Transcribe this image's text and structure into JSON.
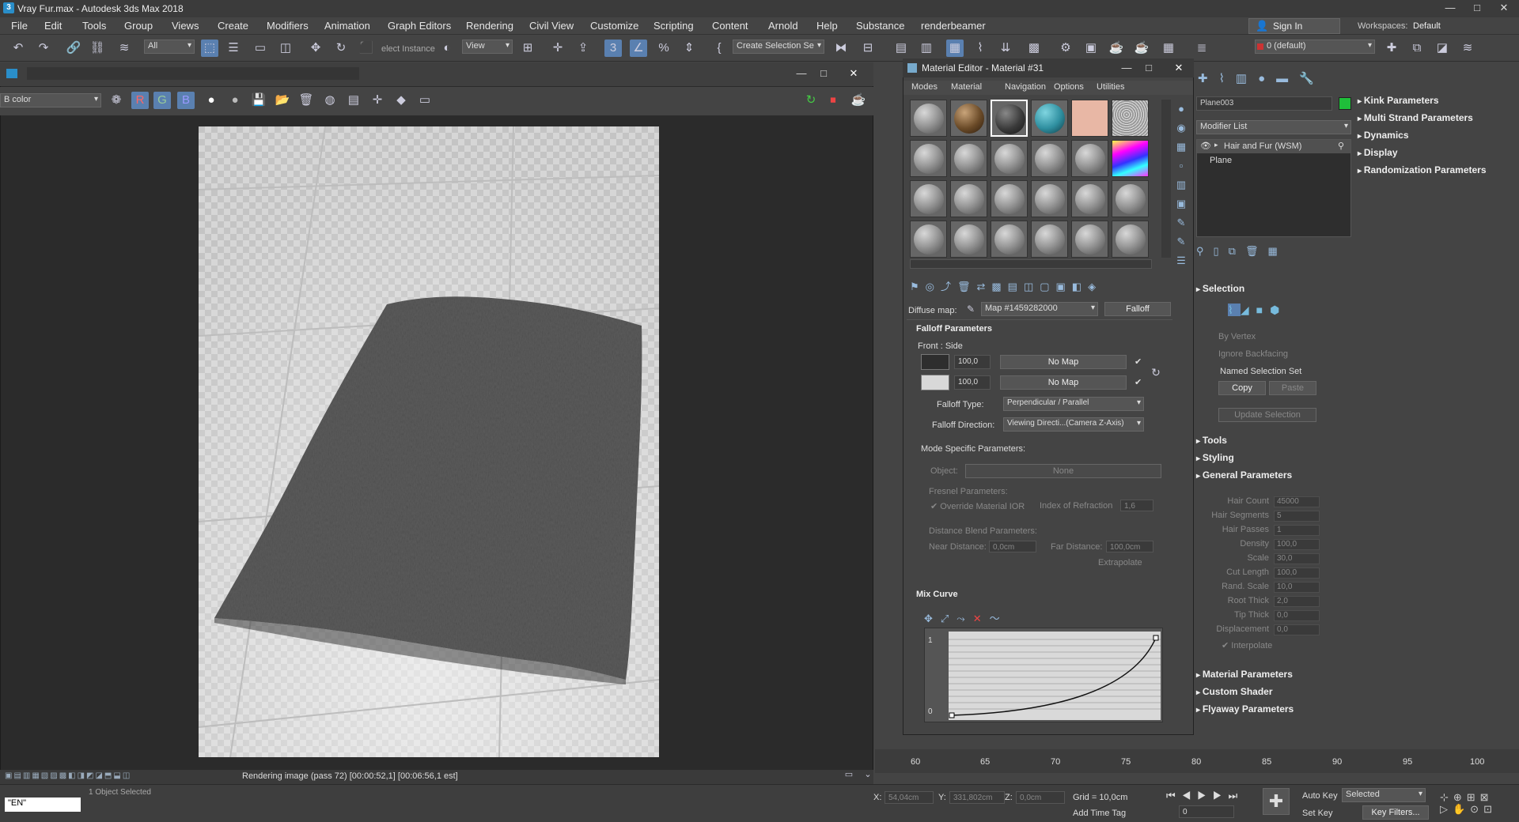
{
  "window": {
    "title": "Vray Fur.max - Autodesk 3ds Max 2018",
    "min": "—",
    "max": "□",
    "close": "✕"
  },
  "menu": [
    "File",
    "Edit",
    "Tools",
    "Group",
    "Views",
    "Create",
    "Modifiers",
    "Animation",
    "Graph Editors",
    "Rendering",
    "Civil View",
    "Customize",
    "Scripting",
    "Content",
    "Arnold",
    "Help",
    "Substance",
    "renderbeamer"
  ],
  "signin": "Sign In",
  "workspaces": {
    "label": "Workspaces:",
    "value": "Default"
  },
  "toolbar": {
    "filter": "All",
    "select_instance": "elect Instance",
    "view": "View",
    "create_selection_set": "Create Selection Se",
    "layer": "0 (default)"
  },
  "framebuffer": {
    "channel": "B color",
    "status": "Rendering image (pass 72) [00:00:52,1] [00:06:56,1 est]",
    "bottom_label": "1 Object Selected"
  },
  "material_editor": {
    "title": "Material Editor - Material #31",
    "menu": [
      "Modes",
      "Material",
      "Navigation",
      "Options",
      "Utilities"
    ],
    "diffuse_label": "Diffuse map:",
    "map_name": "Map #1459282000",
    "map_type": "Falloff",
    "falloff_header": "Falloff Parameters",
    "front_side": "Front : Side",
    "front_value": "100,0",
    "side_value": "100,0",
    "no_map": "No Map",
    "falloff_type_label": "Falloff Type:",
    "falloff_type_value": "Perpendicular / Parallel",
    "falloff_dir_label": "Falloff Direction:",
    "falloff_dir_value": "Viewing Directi...(Camera Z-Axis)",
    "mode_specific": "Mode Specific Parameters:",
    "object_label": "Object:",
    "object_value": "None",
    "fresnel": "Fresnel Parameters:",
    "override_ior": "Override Material IOR",
    "ior_label": "Index of Refraction",
    "ior_value": "1,6",
    "distance_blend": "Distance Blend Parameters:",
    "near_label": "Near Distance:",
    "near_value": "0,0cm",
    "far_label": "Far Distance:",
    "far_value": "100,0cm",
    "extrapolate": "Extrapolate",
    "mix_curve": "Mix Curve",
    "curve_top": "1",
    "curve_bottom": "0",
    "colors": {
      "front": "#2e2e2e",
      "side": "#d8d8d8"
    }
  },
  "command_panel": {
    "object_name": "Plane003",
    "object_color": "#1fbf3a",
    "modifier_list": "Modifier List",
    "stack": [
      "Hair and Fur (WSM)",
      "Plane"
    ],
    "rollouts_right": [
      "Kink Parameters",
      "Multi Strand Parameters",
      "Dynamics",
      "Display",
      "Randomization Parameters"
    ],
    "selection": "Selection",
    "by_vertex": "By Vertex",
    "ignore_backfacing": "Ignore Backfacing",
    "named_sel": "Named Selection Set",
    "copy": "Copy",
    "paste": "Paste",
    "update_sel": "Update Selection",
    "tools": "Tools",
    "styling": "Styling",
    "general": "General Parameters",
    "params": [
      {
        "name": "Hair Count",
        "value": "45000"
      },
      {
        "name": "Hair Segments",
        "value": "5"
      },
      {
        "name": "Hair Passes",
        "value": "1"
      },
      {
        "name": "Density",
        "value": "100,0"
      },
      {
        "name": "Scale",
        "value": "30,0"
      },
      {
        "name": "Cut Length",
        "value": "100,0"
      },
      {
        "name": "Rand. Scale",
        "value": "10,0"
      },
      {
        "name": "Root Thick",
        "value": "2,0"
      },
      {
        "name": "Tip Thick",
        "value": "0,0"
      },
      {
        "name": "Displacement",
        "value": "0,0"
      }
    ],
    "interpolate": "Interpolate",
    "material_params": "Material Parameters",
    "custom_shader": "Custom Shader",
    "flyaway": "Flyaway Parameters"
  },
  "timeline": {
    "ticks": [
      "60",
      "65",
      "70",
      "75",
      "80",
      "85",
      "90",
      "95",
      "100"
    ]
  },
  "status": {
    "x_label": "X:",
    "x_value": "54,04cm",
    "y_label": "Y:",
    "y_value": "331,802cm",
    "z_label": "Z:",
    "z_value": "0,0cm",
    "grid": "Grid = 10,0cm",
    "add_time_tag": "Add Time Tag",
    "auto_key": "Auto Key",
    "set_key": "Set Key",
    "selected": "Selected",
    "key_filters": "Key Filters...",
    "frame": "0",
    "lang": "\"EN\""
  }
}
